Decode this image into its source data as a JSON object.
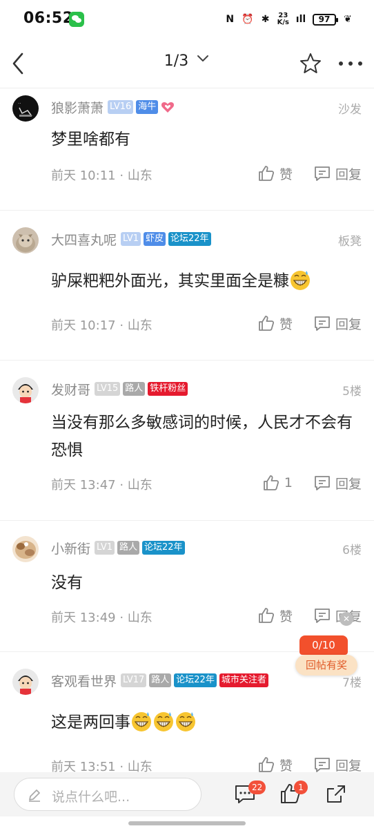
{
  "status_bar": {
    "time": "06:52",
    "net_speed_value": "23",
    "net_speed_unit": "K/s",
    "battery": "97",
    "nfc_glyph": "N",
    "alarm_glyph": "⏰",
    "bt_glyph": "✱",
    "signal_glyph": "ıll",
    "leaf_glyph": "❦"
  },
  "nav": {
    "page_indicator": "1/3",
    "dropdown_glyph": "⌄"
  },
  "comments": [
    {
      "username": "狼影萧萧",
      "badges": [
        {
          "text": "LV16",
          "style": "lv-blue"
        },
        {
          "text": "海牛",
          "style": "blue"
        }
      ],
      "has_heart": true,
      "floor": "沙发",
      "content": "梦里啥都有",
      "emoji_count": 0,
      "time": "前天 10:11 · 山东",
      "like": "赞",
      "reply": "回复"
    },
    {
      "username": "大四喜丸呢",
      "badges": [
        {
          "text": "LV1",
          "style": "lv-blue"
        },
        {
          "text": "虾皮",
          "style": "blue"
        },
        {
          "text": "论坛22年",
          "style": "teal"
        }
      ],
      "floor": "板凳",
      "content": "驴屎粑粑外面光，其实里面全是糠",
      "emoji_count": 1,
      "time": "前天 10:17 · 山东",
      "like": "赞",
      "reply": "回复"
    },
    {
      "username": "发财哥",
      "badges": [
        {
          "text": "LV15",
          "style": "lv-grey"
        },
        {
          "text": "路人",
          "style": "grey"
        },
        {
          "text": "铁杆粉丝",
          "style": "red"
        }
      ],
      "floor": "5楼",
      "content": "当没有那么多敏感词的时候，人民才不会有恐惧",
      "emoji_count": 0,
      "time": "前天 13:47 · 山东",
      "like": "1",
      "reply": "回复"
    },
    {
      "username": "小新街",
      "badges": [
        {
          "text": "LV1",
          "style": "lv-grey"
        },
        {
          "text": "路人",
          "style": "grey"
        },
        {
          "text": "论坛22年",
          "style": "teal"
        }
      ],
      "floor": "6楼",
      "content": "没有",
      "emoji_count": 0,
      "time": "前天 13:49 · 山东",
      "like": "赞",
      "reply": "回复"
    },
    {
      "username": "客观看世界",
      "badges": [
        {
          "text": "LV17",
          "style": "lv-grey"
        },
        {
          "text": "路人",
          "style": "grey"
        },
        {
          "text": "论坛22年",
          "style": "teal"
        },
        {
          "text": "城市关注者",
          "style": "red"
        }
      ],
      "floor": "7楼",
      "content": "这是两回事",
      "emoji_count": 3,
      "time": "前天 13:51 · 山东",
      "like": "赞",
      "reply": "回复"
    }
  ],
  "reward": {
    "progress": "0/10",
    "label": "回帖有奖",
    "close_glyph": "✕"
  },
  "bottom_bar": {
    "placeholder": "说点什么吧...",
    "comment_count": "22",
    "like_count": "1"
  },
  "colors": {
    "accent_red": "#f2503a",
    "badge_blue": "#4f8de8",
    "badge_teal": "#1a92c9",
    "badge_red": "#e51a2e",
    "badge_grey": "#a9a9a9"
  }
}
